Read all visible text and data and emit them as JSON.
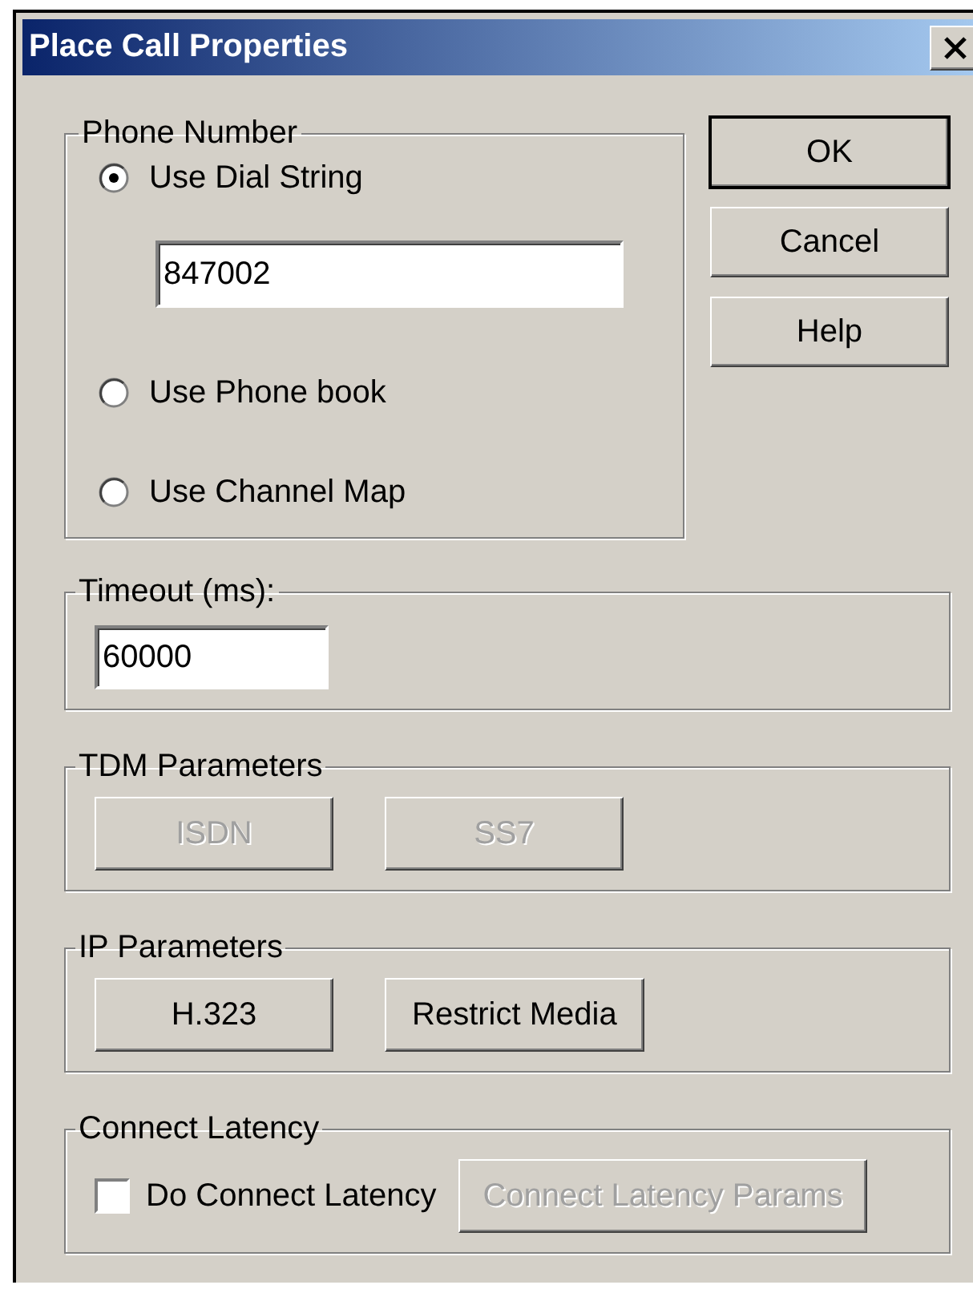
{
  "window": {
    "title": "Place Call Properties"
  },
  "phone_number": {
    "label": "Phone Number",
    "dial_string": "847002",
    "options": [
      {
        "label": "Use Dial String",
        "selected": true
      },
      {
        "label": "Use Phone book",
        "selected": false
      },
      {
        "label": "Use Channel Map",
        "selected": false
      }
    ]
  },
  "buttons": [
    {
      "label": "OK",
      "default": true
    },
    {
      "label": "Cancel",
      "default": false
    },
    {
      "label": "Help",
      "default": false
    }
  ],
  "timeout": {
    "label": "Timeout (ms):",
    "value": "60000"
  },
  "tdm_parameters": {
    "label": "TDM Parameters",
    "buttons": [
      {
        "label": "ISDN",
        "disabled": true
      },
      {
        "label": "SS7",
        "disabled": true
      }
    ]
  },
  "ip_parameters": {
    "label": "IP Parameters",
    "buttons": [
      {
        "label": "H.323",
        "disabled": false
      },
      {
        "label": "Restrict Media",
        "disabled": false
      }
    ]
  },
  "connect_latency": {
    "label": "Connect Latency",
    "checkbox": {
      "label": "Do Connect Latency",
      "checked": false
    },
    "button": {
      "label": "Connect Latency Params",
      "disabled": true
    }
  }
}
